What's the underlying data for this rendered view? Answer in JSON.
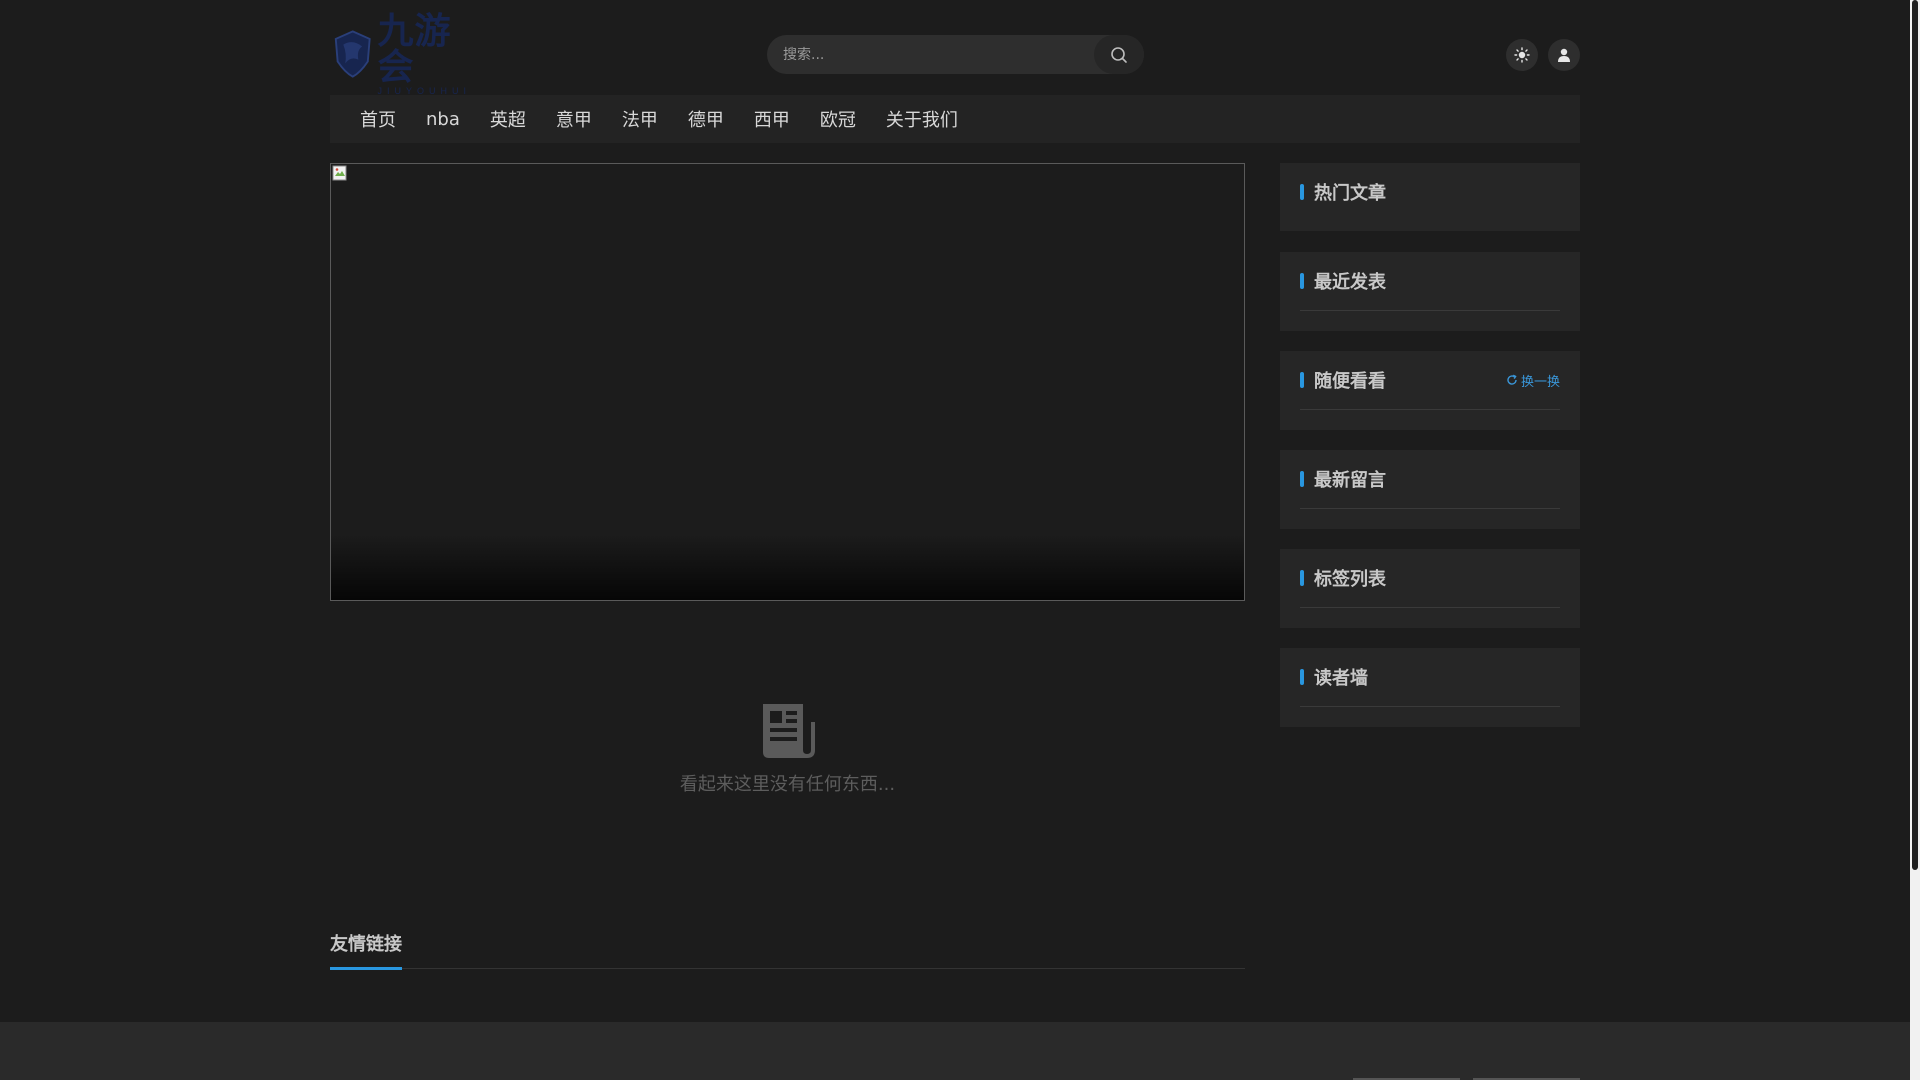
{
  "header": {
    "logo_title": "九游会",
    "logo_subtitle": "JIUYOUHUI",
    "search_placeholder": "搜索..."
  },
  "nav": {
    "items": [
      "首页",
      "nba",
      "英超",
      "意甲",
      "法甲",
      "德甲",
      "西甲",
      "欧冠",
      "关于我们"
    ]
  },
  "main": {
    "empty_text": "看起来这里没有任何东西...",
    "friend_links_title": "友情链接"
  },
  "sidebar": {
    "hot_articles": "热门文章",
    "recent_posts": "最近发表",
    "random_view": "随便看看",
    "refresh_label": "换一换",
    "latest_comments": "最新留言",
    "tag_list": "标签列表",
    "readers_wall": "读者墙"
  },
  "colors": {
    "background": "#1c1c1c",
    "panel": "#262626",
    "accent": "#2997e0",
    "logo_navy": "#17254f"
  },
  "icons": [
    "search-icon",
    "sun-icon",
    "user-icon",
    "newspaper-icon",
    "refresh-icon",
    "broken-image-icon"
  ]
}
